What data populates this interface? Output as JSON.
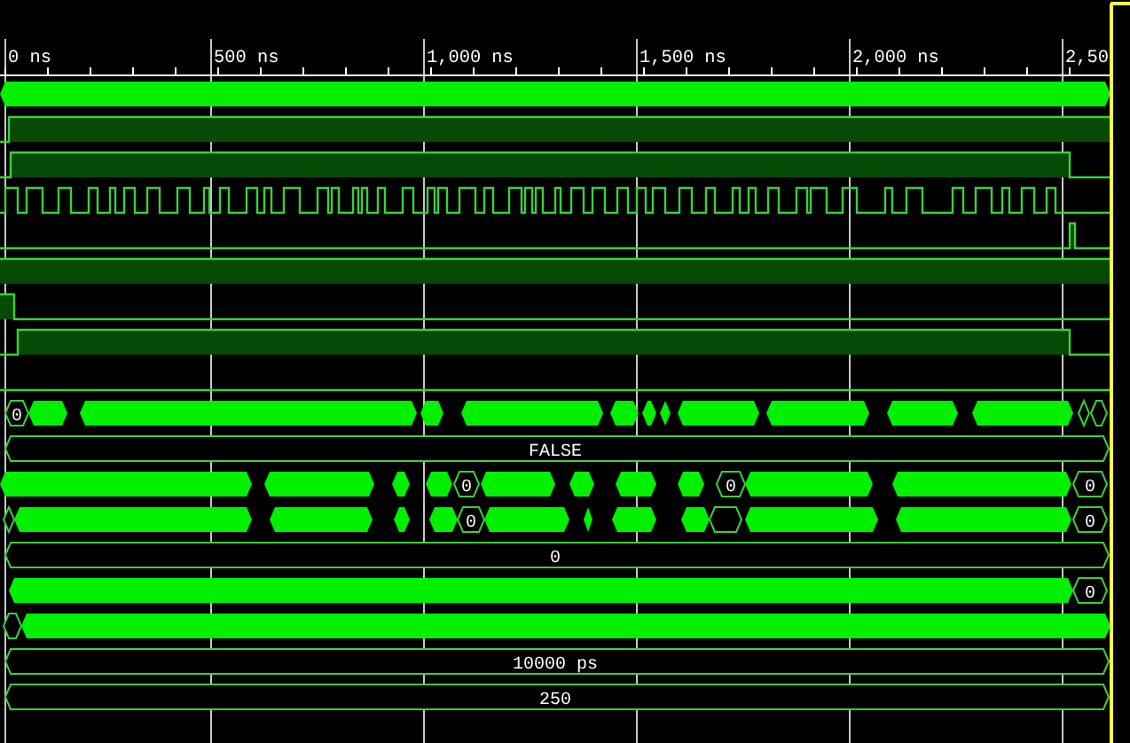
{
  "time_axis": {
    "ticks": [
      "0 ns",
      "500 ns",
      "1,000 ns",
      "1,500 ns",
      "2,000 ns",
      "2,50"
    ]
  },
  "signals": [
    {
      "kind": "bus"
    },
    {
      "kind": "bit"
    },
    {
      "kind": "bit"
    },
    {
      "kind": "clock"
    },
    {
      "kind": "bit"
    },
    {
      "kind": "bit"
    },
    {
      "kind": "bit"
    },
    {
      "kind": "bit"
    },
    {
      "kind": "bit"
    },
    {
      "kind": "bus",
      "values": [
        "0"
      ]
    },
    {
      "kind": "bus_value",
      "values": [
        "FALSE"
      ]
    },
    {
      "kind": "bus",
      "values": [
        "0",
        "0",
        "0"
      ]
    },
    {
      "kind": "bus",
      "values": [
        "0",
        "0"
      ]
    },
    {
      "kind": "bus_value",
      "values": [
        "0"
      ]
    },
    {
      "kind": "bus",
      "values": [
        "0"
      ]
    },
    {
      "kind": "bus"
    },
    {
      "kind": "bus_value",
      "values": [
        "10000 ps"
      ]
    },
    {
      "kind": "bus_value",
      "values": [
        "250"
      ]
    }
  ]
}
